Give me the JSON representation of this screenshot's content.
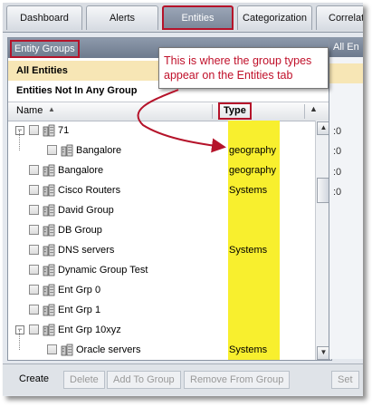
{
  "tabs": [
    {
      "label": "Dashboard"
    },
    {
      "label": "Alerts"
    },
    {
      "label": "Entities"
    },
    {
      "label": "Categorization"
    },
    {
      "label": "Correlat"
    }
  ],
  "panel": {
    "title": "Entity Groups",
    "groups": [
      "All Entities",
      "Entities Not In Any Group"
    ],
    "columns": {
      "name": "Name",
      "type": "Type"
    }
  },
  "rows": [
    {
      "name": "71",
      "type": ""
    },
    {
      "name": "Bangalore",
      "type": "geography"
    },
    {
      "name": "Bangalore",
      "type": "geography"
    },
    {
      "name": "Cisco Routers",
      "type": "Systems"
    },
    {
      "name": "David Group",
      "type": ""
    },
    {
      "name": "DB Group",
      "type": ""
    },
    {
      "name": "DNS servers",
      "type": "Systems"
    },
    {
      "name": "Dynamic Group Test",
      "type": ""
    },
    {
      "name": "Ent Grp 0",
      "type": ""
    },
    {
      "name": "Ent Grp 1",
      "type": ""
    },
    {
      "name": "Ent Grp 10xyz",
      "type": ""
    },
    {
      "name": "Oracle servers",
      "type": "Systems"
    }
  ],
  "right_panel": {
    "header": "All En",
    "cells": [
      ":0",
      ":0",
      ":0",
      ":0"
    ]
  },
  "buttons": {
    "create": "Create",
    "delete": "Delete",
    "add_to_group": "Add To Group",
    "remove_from_group": "Remove From Group",
    "set": "Set"
  },
  "callout": {
    "text": "This is where the group types appear on the Entities tab"
  },
  "colors": {
    "highlight": "#f8ef2e",
    "annotation": "#b5132a",
    "selected_row": "#f7e6b5"
  }
}
